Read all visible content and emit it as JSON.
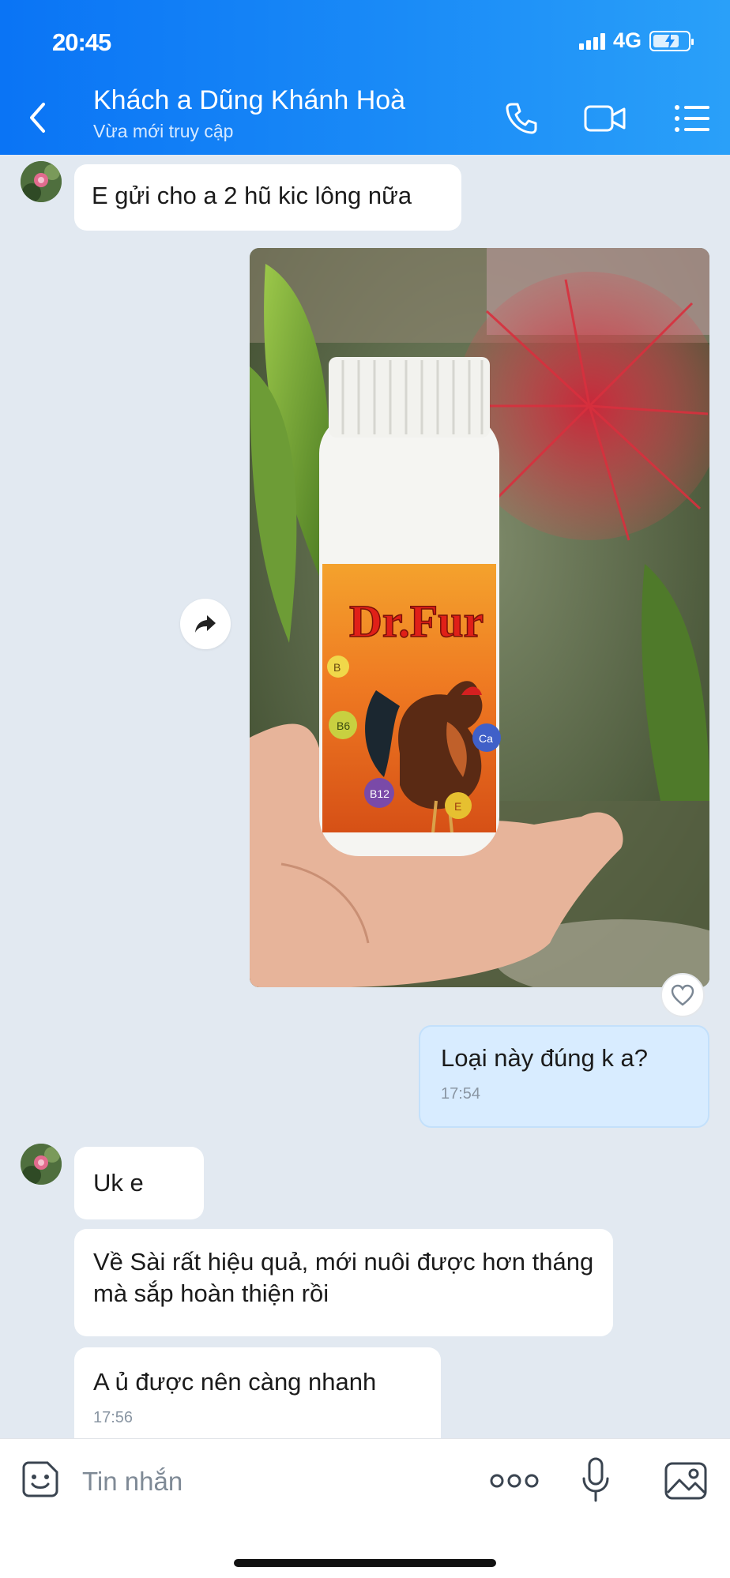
{
  "status_bar": {
    "time": "20:45",
    "network": "4G"
  },
  "header": {
    "contact_name": "Khách a Dũng Khánh Hoà",
    "contact_status": "Vừa mới truy cập"
  },
  "messages": {
    "m1": {
      "text": "E gửi cho a 2 hũ kic lông nữa"
    },
    "photo": {
      "product_label": "Dr.Fur",
      "vitamin_labels": [
        "B",
        "B6",
        "B12",
        "E",
        "Ca"
      ]
    },
    "m2": {
      "text": "Loại này đúng k a?",
      "time": "17:54"
    },
    "m3": {
      "text": "Uk e"
    },
    "m4": {
      "text": "Về Sài rất hiệu quả, mới nuôi được hơn tháng mà sắp hoàn thiện rồi"
    },
    "m5": {
      "text": "A ủ được nên càng nhanh",
      "time": "17:56"
    }
  },
  "input_bar": {
    "placeholder": "Tin nhắn"
  },
  "colors": {
    "header_accent": "#0a74f5",
    "chat_bg": "#e2e9f1",
    "my_bubble": "#d8ecff"
  }
}
